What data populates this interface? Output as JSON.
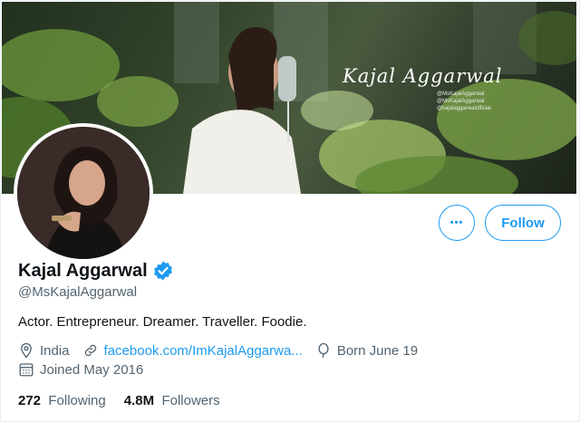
{
  "banner": {
    "signature": "Kajal Aggarwal",
    "handles": [
      "@MsKajalAggarwal",
      "@MsKajalAggarwal",
      "@kajalaggarwalofficial"
    ]
  },
  "actions": {
    "more_label": "•••",
    "follow_label": "Follow"
  },
  "profile": {
    "name": "Kajal Aggarwal",
    "handle": "@MsKajalAggarwal",
    "bio": "Actor. Entrepreneur. Dreamer. Traveller. Foodie.",
    "location": "India",
    "website": "facebook.com/ImKajalAggarwa...",
    "birthday": "Born June 19",
    "joined": "Joined May 2016",
    "verified": true
  },
  "stats": {
    "following_count": "272",
    "following_label": "Following",
    "followers_count": "4.8M",
    "followers_label": "Followers"
  },
  "colors": {
    "accent": "#1d9bf0",
    "secondary_text": "#536471",
    "primary_text": "#0f1419"
  }
}
